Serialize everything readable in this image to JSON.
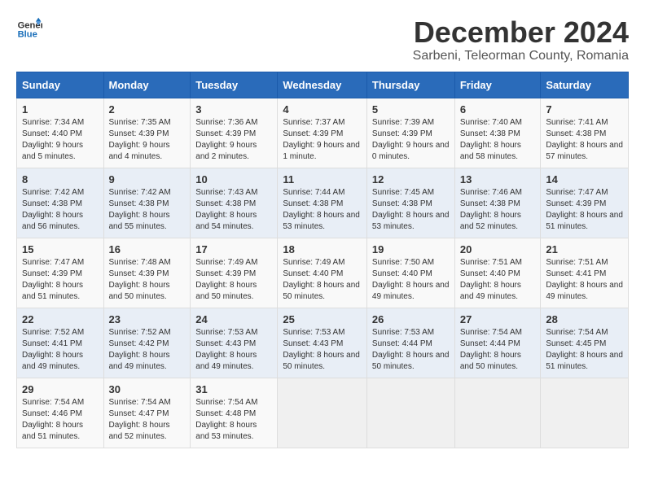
{
  "header": {
    "logo_line1": "General",
    "logo_line2": "Blue",
    "title": "December 2024",
    "subtitle": "Sarbeni, Teleorman County, Romania"
  },
  "weekdays": [
    "Sunday",
    "Monday",
    "Tuesday",
    "Wednesday",
    "Thursday",
    "Friday",
    "Saturday"
  ],
  "weeks": [
    [
      {
        "day": "1",
        "sunrise": "Sunrise: 7:34 AM",
        "sunset": "Sunset: 4:40 PM",
        "daylight": "Daylight: 9 hours and 5 minutes."
      },
      {
        "day": "2",
        "sunrise": "Sunrise: 7:35 AM",
        "sunset": "Sunset: 4:39 PM",
        "daylight": "Daylight: 9 hours and 4 minutes."
      },
      {
        "day": "3",
        "sunrise": "Sunrise: 7:36 AM",
        "sunset": "Sunset: 4:39 PM",
        "daylight": "Daylight: 9 hours and 2 minutes."
      },
      {
        "day": "4",
        "sunrise": "Sunrise: 7:37 AM",
        "sunset": "Sunset: 4:39 PM",
        "daylight": "Daylight: 9 hours and 1 minute."
      },
      {
        "day": "5",
        "sunrise": "Sunrise: 7:39 AM",
        "sunset": "Sunset: 4:39 PM",
        "daylight": "Daylight: 9 hours and 0 minutes."
      },
      {
        "day": "6",
        "sunrise": "Sunrise: 7:40 AM",
        "sunset": "Sunset: 4:38 PM",
        "daylight": "Daylight: 8 hours and 58 minutes."
      },
      {
        "day": "7",
        "sunrise": "Sunrise: 7:41 AM",
        "sunset": "Sunset: 4:38 PM",
        "daylight": "Daylight: 8 hours and 57 minutes."
      }
    ],
    [
      {
        "day": "8",
        "sunrise": "Sunrise: 7:42 AM",
        "sunset": "Sunset: 4:38 PM",
        "daylight": "Daylight: 8 hours and 56 minutes."
      },
      {
        "day": "9",
        "sunrise": "Sunrise: 7:42 AM",
        "sunset": "Sunset: 4:38 PM",
        "daylight": "Daylight: 8 hours and 55 minutes."
      },
      {
        "day": "10",
        "sunrise": "Sunrise: 7:43 AM",
        "sunset": "Sunset: 4:38 PM",
        "daylight": "Daylight: 8 hours and 54 minutes."
      },
      {
        "day": "11",
        "sunrise": "Sunrise: 7:44 AM",
        "sunset": "Sunset: 4:38 PM",
        "daylight": "Daylight: 8 hours and 53 minutes."
      },
      {
        "day": "12",
        "sunrise": "Sunrise: 7:45 AM",
        "sunset": "Sunset: 4:38 PM",
        "daylight": "Daylight: 8 hours and 53 minutes."
      },
      {
        "day": "13",
        "sunrise": "Sunrise: 7:46 AM",
        "sunset": "Sunset: 4:38 PM",
        "daylight": "Daylight: 8 hours and 52 minutes."
      },
      {
        "day": "14",
        "sunrise": "Sunrise: 7:47 AM",
        "sunset": "Sunset: 4:39 PM",
        "daylight": "Daylight: 8 hours and 51 minutes."
      }
    ],
    [
      {
        "day": "15",
        "sunrise": "Sunrise: 7:47 AM",
        "sunset": "Sunset: 4:39 PM",
        "daylight": "Daylight: 8 hours and 51 minutes."
      },
      {
        "day": "16",
        "sunrise": "Sunrise: 7:48 AM",
        "sunset": "Sunset: 4:39 PM",
        "daylight": "Daylight: 8 hours and 50 minutes."
      },
      {
        "day": "17",
        "sunrise": "Sunrise: 7:49 AM",
        "sunset": "Sunset: 4:39 PM",
        "daylight": "Daylight: 8 hours and 50 minutes."
      },
      {
        "day": "18",
        "sunrise": "Sunrise: 7:49 AM",
        "sunset": "Sunset: 4:40 PM",
        "daylight": "Daylight: 8 hours and 50 minutes."
      },
      {
        "day": "19",
        "sunrise": "Sunrise: 7:50 AM",
        "sunset": "Sunset: 4:40 PM",
        "daylight": "Daylight: 8 hours and 49 minutes."
      },
      {
        "day": "20",
        "sunrise": "Sunrise: 7:51 AM",
        "sunset": "Sunset: 4:40 PM",
        "daylight": "Daylight: 8 hours and 49 minutes."
      },
      {
        "day": "21",
        "sunrise": "Sunrise: 7:51 AM",
        "sunset": "Sunset: 4:41 PM",
        "daylight": "Daylight: 8 hours and 49 minutes."
      }
    ],
    [
      {
        "day": "22",
        "sunrise": "Sunrise: 7:52 AM",
        "sunset": "Sunset: 4:41 PM",
        "daylight": "Daylight: 8 hours and 49 minutes."
      },
      {
        "day": "23",
        "sunrise": "Sunrise: 7:52 AM",
        "sunset": "Sunset: 4:42 PM",
        "daylight": "Daylight: 8 hours and 49 minutes."
      },
      {
        "day": "24",
        "sunrise": "Sunrise: 7:53 AM",
        "sunset": "Sunset: 4:43 PM",
        "daylight": "Daylight: 8 hours and 49 minutes."
      },
      {
        "day": "25",
        "sunrise": "Sunrise: 7:53 AM",
        "sunset": "Sunset: 4:43 PM",
        "daylight": "Daylight: 8 hours and 50 minutes."
      },
      {
        "day": "26",
        "sunrise": "Sunrise: 7:53 AM",
        "sunset": "Sunset: 4:44 PM",
        "daylight": "Daylight: 8 hours and 50 minutes."
      },
      {
        "day": "27",
        "sunrise": "Sunrise: 7:54 AM",
        "sunset": "Sunset: 4:44 PM",
        "daylight": "Daylight: 8 hours and 50 minutes."
      },
      {
        "day": "28",
        "sunrise": "Sunrise: 7:54 AM",
        "sunset": "Sunset: 4:45 PM",
        "daylight": "Daylight: 8 hours and 51 minutes."
      }
    ],
    [
      {
        "day": "29",
        "sunrise": "Sunrise: 7:54 AM",
        "sunset": "Sunset: 4:46 PM",
        "daylight": "Daylight: 8 hours and 51 minutes."
      },
      {
        "day": "30",
        "sunrise": "Sunrise: 7:54 AM",
        "sunset": "Sunset: 4:47 PM",
        "daylight": "Daylight: 8 hours and 52 minutes."
      },
      {
        "day": "31",
        "sunrise": "Sunrise: 7:54 AM",
        "sunset": "Sunset: 4:48 PM",
        "daylight": "Daylight: 8 hours and 53 minutes."
      },
      null,
      null,
      null,
      null
    ]
  ]
}
